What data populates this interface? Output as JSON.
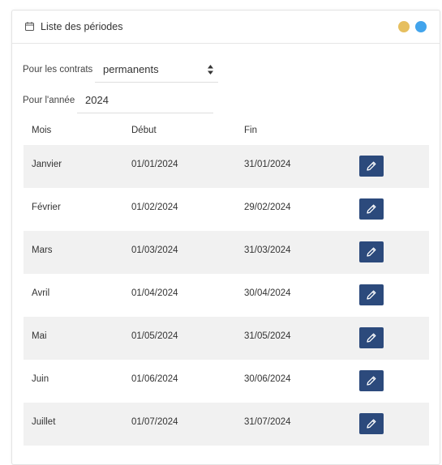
{
  "header": {
    "title": "Liste des périodes",
    "calendar_icon": "calendar-icon",
    "dot_colors": [
      "#e6bf5f",
      "#42a4ec"
    ]
  },
  "filters": {
    "contract_label": "Pour les contrats",
    "contract_value": "permanents",
    "year_label": "Pour l'année",
    "year_value": "2024"
  },
  "table": {
    "headers": [
      "Mois",
      "Début",
      "Fin"
    ],
    "rows": [
      {
        "month": "Janvier",
        "start": "01/01/2024",
        "end": "31/01/2024"
      },
      {
        "month": "Février",
        "start": "01/02/2024",
        "end": "29/02/2024"
      },
      {
        "month": "Mars",
        "start": "01/03/2024",
        "end": "31/03/2024"
      },
      {
        "month": "Avril",
        "start": "01/04/2024",
        "end": "30/04/2024"
      },
      {
        "month": "Mai",
        "start": "01/05/2024",
        "end": "31/05/2024"
      },
      {
        "month": "Juin",
        "start": "01/06/2024",
        "end": "30/06/2024"
      },
      {
        "month": "Juillet",
        "start": "01/07/2024",
        "end": "31/07/2024"
      }
    ],
    "edit_icon": "pencil-icon",
    "edit_button_color": "#2c4a7c",
    "striped_row_color": "#f1f1f1"
  }
}
